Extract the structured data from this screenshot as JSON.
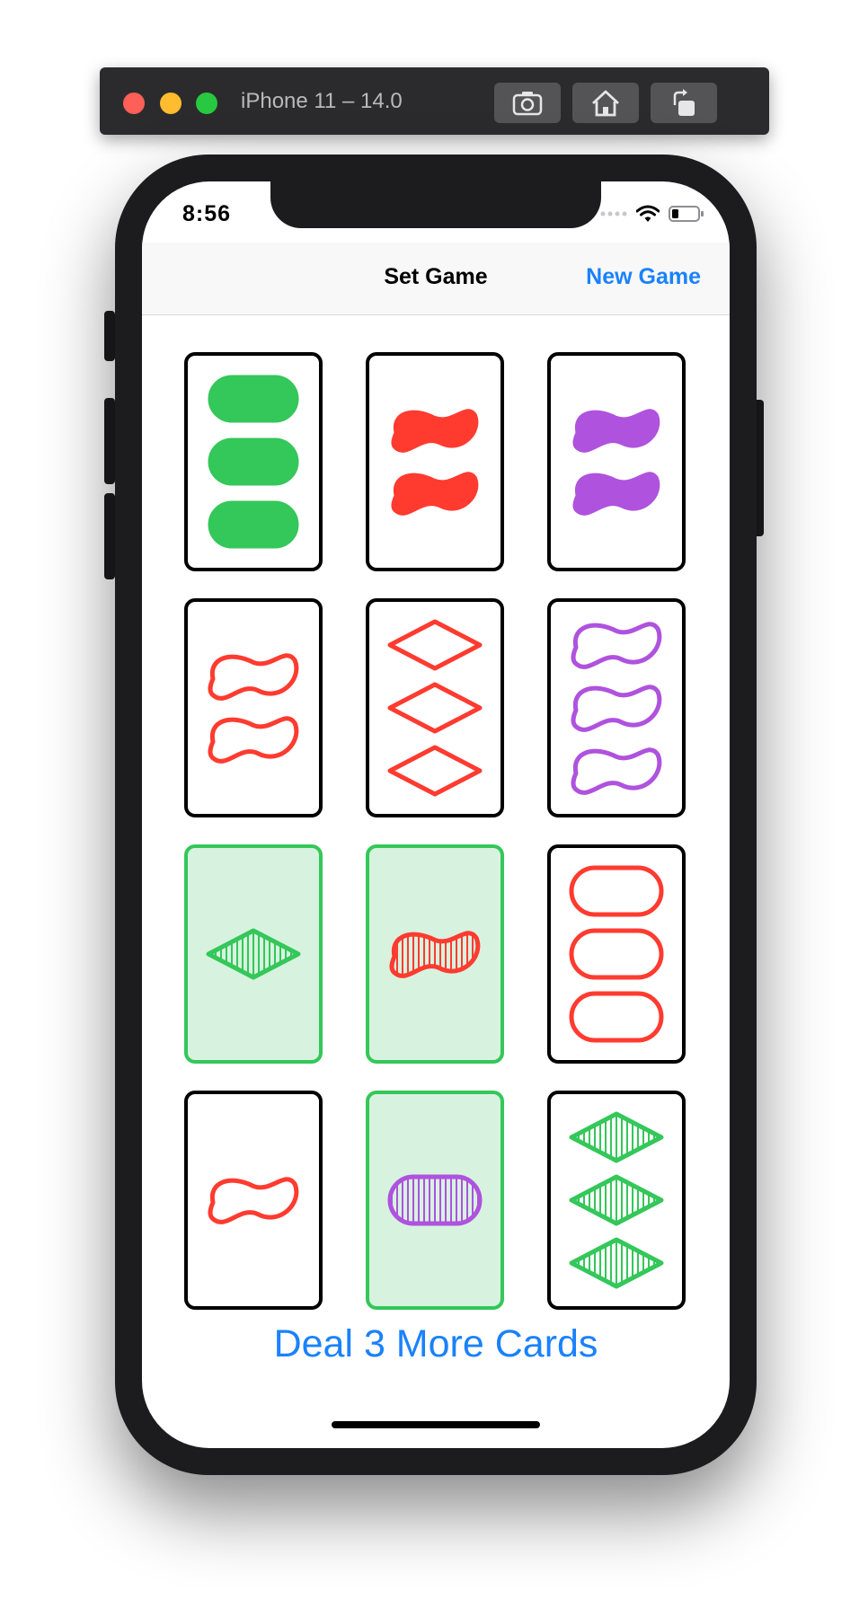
{
  "simulator": {
    "title": "iPhone 11 – 14.0",
    "buttons": [
      {
        "name": "screenshot-icon"
      },
      {
        "name": "home-icon"
      },
      {
        "name": "rotate-icon"
      }
    ]
  },
  "status_bar": {
    "time": "8:56"
  },
  "nav": {
    "title": "Set Game",
    "action": "New Game"
  },
  "colors": {
    "green": "#34c759",
    "red": "#ff3b30",
    "purple": "#af52de",
    "selected_border": "#34c759",
    "selected_fill": "#d7f3e0",
    "link": "#1a82fb"
  },
  "cards": [
    {
      "count": 3,
      "shape": "oval",
      "fill": "solid",
      "color": "green",
      "selected": false
    },
    {
      "count": 2,
      "shape": "squiggle",
      "fill": "solid",
      "color": "red",
      "selected": false
    },
    {
      "count": 2,
      "shape": "squiggle",
      "fill": "solid",
      "color": "purple",
      "selected": false
    },
    {
      "count": 2,
      "shape": "squiggle",
      "fill": "open",
      "color": "red",
      "selected": false
    },
    {
      "count": 3,
      "shape": "diamond",
      "fill": "open",
      "color": "red",
      "selected": false
    },
    {
      "count": 3,
      "shape": "squiggle",
      "fill": "open",
      "color": "purple",
      "selected": false
    },
    {
      "count": 1,
      "shape": "diamond",
      "fill": "striped",
      "color": "green",
      "selected": true
    },
    {
      "count": 1,
      "shape": "squiggle",
      "fill": "striped",
      "color": "red",
      "selected": true
    },
    {
      "count": 3,
      "shape": "oval",
      "fill": "open",
      "color": "red",
      "selected": false
    },
    {
      "count": 1,
      "shape": "squiggle",
      "fill": "open",
      "color": "red",
      "selected": false
    },
    {
      "count": 1,
      "shape": "oval",
      "fill": "striped",
      "color": "purple",
      "selected": true
    },
    {
      "count": 3,
      "shape": "diamond",
      "fill": "striped",
      "color": "green",
      "selected": false
    }
  ],
  "deal_button": "Deal 3 More Cards"
}
